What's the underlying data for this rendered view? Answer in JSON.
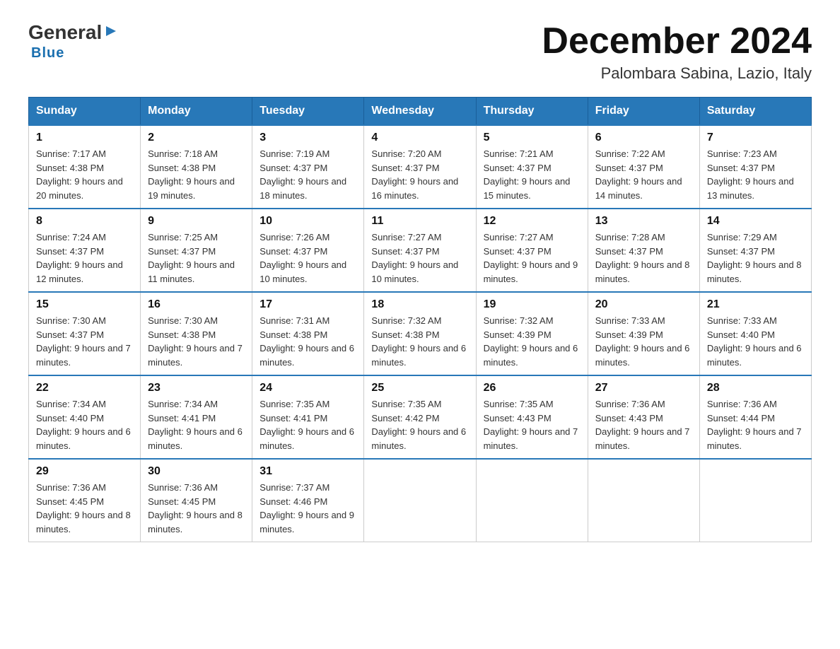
{
  "header": {
    "logo": {
      "general": "General",
      "triangle": "▶",
      "blue": "Blue"
    },
    "title": "December 2024",
    "location": "Palombara Sabina, Lazio, Italy"
  },
  "weekdays": [
    "Sunday",
    "Monday",
    "Tuesday",
    "Wednesday",
    "Thursday",
    "Friday",
    "Saturday"
  ],
  "weeks": [
    [
      {
        "day": "1",
        "sunrise": "7:17 AM",
        "sunset": "4:38 PM",
        "daylight": "9 hours and 20 minutes."
      },
      {
        "day": "2",
        "sunrise": "7:18 AM",
        "sunset": "4:38 PM",
        "daylight": "9 hours and 19 minutes."
      },
      {
        "day": "3",
        "sunrise": "7:19 AM",
        "sunset": "4:37 PM",
        "daylight": "9 hours and 18 minutes."
      },
      {
        "day": "4",
        "sunrise": "7:20 AM",
        "sunset": "4:37 PM",
        "daylight": "9 hours and 16 minutes."
      },
      {
        "day": "5",
        "sunrise": "7:21 AM",
        "sunset": "4:37 PM",
        "daylight": "9 hours and 15 minutes."
      },
      {
        "day": "6",
        "sunrise": "7:22 AM",
        "sunset": "4:37 PM",
        "daylight": "9 hours and 14 minutes."
      },
      {
        "day": "7",
        "sunrise": "7:23 AM",
        "sunset": "4:37 PM",
        "daylight": "9 hours and 13 minutes."
      }
    ],
    [
      {
        "day": "8",
        "sunrise": "7:24 AM",
        "sunset": "4:37 PM",
        "daylight": "9 hours and 12 minutes."
      },
      {
        "day": "9",
        "sunrise": "7:25 AM",
        "sunset": "4:37 PM",
        "daylight": "9 hours and 11 minutes."
      },
      {
        "day": "10",
        "sunrise": "7:26 AM",
        "sunset": "4:37 PM",
        "daylight": "9 hours and 10 minutes."
      },
      {
        "day": "11",
        "sunrise": "7:27 AM",
        "sunset": "4:37 PM",
        "daylight": "9 hours and 10 minutes."
      },
      {
        "day": "12",
        "sunrise": "7:27 AM",
        "sunset": "4:37 PM",
        "daylight": "9 hours and 9 minutes."
      },
      {
        "day": "13",
        "sunrise": "7:28 AM",
        "sunset": "4:37 PM",
        "daylight": "9 hours and 8 minutes."
      },
      {
        "day": "14",
        "sunrise": "7:29 AM",
        "sunset": "4:37 PM",
        "daylight": "9 hours and 8 minutes."
      }
    ],
    [
      {
        "day": "15",
        "sunrise": "7:30 AM",
        "sunset": "4:37 PM",
        "daylight": "9 hours and 7 minutes."
      },
      {
        "day": "16",
        "sunrise": "7:30 AM",
        "sunset": "4:38 PM",
        "daylight": "9 hours and 7 minutes."
      },
      {
        "day": "17",
        "sunrise": "7:31 AM",
        "sunset": "4:38 PM",
        "daylight": "9 hours and 6 minutes."
      },
      {
        "day": "18",
        "sunrise": "7:32 AM",
        "sunset": "4:38 PM",
        "daylight": "9 hours and 6 minutes."
      },
      {
        "day": "19",
        "sunrise": "7:32 AM",
        "sunset": "4:39 PM",
        "daylight": "9 hours and 6 minutes."
      },
      {
        "day": "20",
        "sunrise": "7:33 AM",
        "sunset": "4:39 PM",
        "daylight": "9 hours and 6 minutes."
      },
      {
        "day": "21",
        "sunrise": "7:33 AM",
        "sunset": "4:40 PM",
        "daylight": "9 hours and 6 minutes."
      }
    ],
    [
      {
        "day": "22",
        "sunrise": "7:34 AM",
        "sunset": "4:40 PM",
        "daylight": "9 hours and 6 minutes."
      },
      {
        "day": "23",
        "sunrise": "7:34 AM",
        "sunset": "4:41 PM",
        "daylight": "9 hours and 6 minutes."
      },
      {
        "day": "24",
        "sunrise": "7:35 AM",
        "sunset": "4:41 PM",
        "daylight": "9 hours and 6 minutes."
      },
      {
        "day": "25",
        "sunrise": "7:35 AM",
        "sunset": "4:42 PM",
        "daylight": "9 hours and 6 minutes."
      },
      {
        "day": "26",
        "sunrise": "7:35 AM",
        "sunset": "4:43 PM",
        "daylight": "9 hours and 7 minutes."
      },
      {
        "day": "27",
        "sunrise": "7:36 AM",
        "sunset": "4:43 PM",
        "daylight": "9 hours and 7 minutes."
      },
      {
        "day": "28",
        "sunrise": "7:36 AM",
        "sunset": "4:44 PM",
        "daylight": "9 hours and 7 minutes."
      }
    ],
    [
      {
        "day": "29",
        "sunrise": "7:36 AM",
        "sunset": "4:45 PM",
        "daylight": "9 hours and 8 minutes."
      },
      {
        "day": "30",
        "sunrise": "7:36 AM",
        "sunset": "4:45 PM",
        "daylight": "9 hours and 8 minutes."
      },
      {
        "day": "31",
        "sunrise": "7:37 AM",
        "sunset": "4:46 PM",
        "daylight": "9 hours and 9 minutes."
      },
      null,
      null,
      null,
      null
    ]
  ]
}
